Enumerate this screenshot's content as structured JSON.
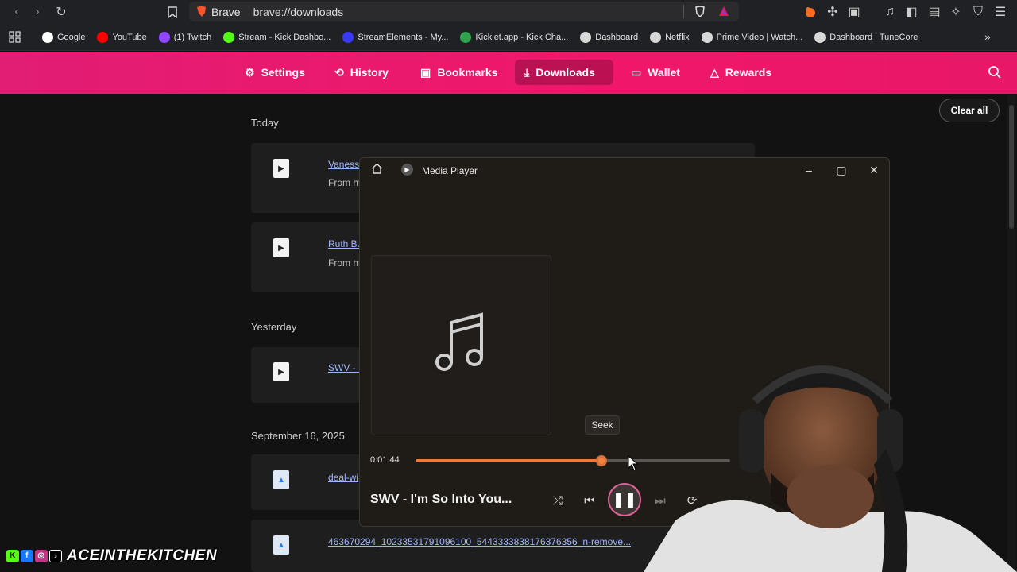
{
  "browser": {
    "brand": "Brave",
    "url": "brave://downloads"
  },
  "bookmarks": [
    {
      "label": "Google",
      "color": "#ffffff"
    },
    {
      "label": "YouTube",
      "color": "#ff0000"
    },
    {
      "label": "(1) Twitch",
      "color": "#9146ff"
    },
    {
      "label": "Stream - Kick Dashbo...",
      "color": "#53fc18"
    },
    {
      "label": "StreamElements - My...",
      "color": "#3a3af5"
    },
    {
      "label": "Kicklet.app - Kick Cha...",
      "color": "#2fa34b"
    },
    {
      "label": "Dashboard",
      "color": "#d8d8d8"
    },
    {
      "label": "Netflix",
      "color": "#d8d8d8"
    },
    {
      "label": "Prime Video | Watch...",
      "color": "#d8d8d8"
    },
    {
      "label": "Dashboard | TuneCore",
      "color": "#d8d8d8"
    }
  ],
  "nav": {
    "settings": "Settings",
    "history": "History",
    "bookmarks": "Bookmarks",
    "downloads": "Downloads",
    "wallet": "Wallet",
    "rewards": "Rewards"
  },
  "downloads": {
    "clear_all": "Clear all",
    "sections": {
      "today": "Today",
      "yesterday": "Yesterday",
      "sep16": "September 16, 2025"
    },
    "items": [
      {
        "name": "Vanessa",
        "from": "From ht"
      },
      {
        "name": "Ruth B.",
        "from": "From ht"
      },
      {
        "name": "SWV - I"
      },
      {
        "name": "deal-wi"
      },
      {
        "name": "463670294_10233531791096100_5443333838176376356_n-remove..."
      }
    ]
  },
  "player": {
    "title": "Media Player",
    "seek_tooltip": "Seek",
    "time": "0:01:44",
    "progress": 0.59,
    "song": "SWV - I'm So Into You..."
  },
  "overlay": {
    "channel": "ACEINTHEKITCHEN"
  }
}
